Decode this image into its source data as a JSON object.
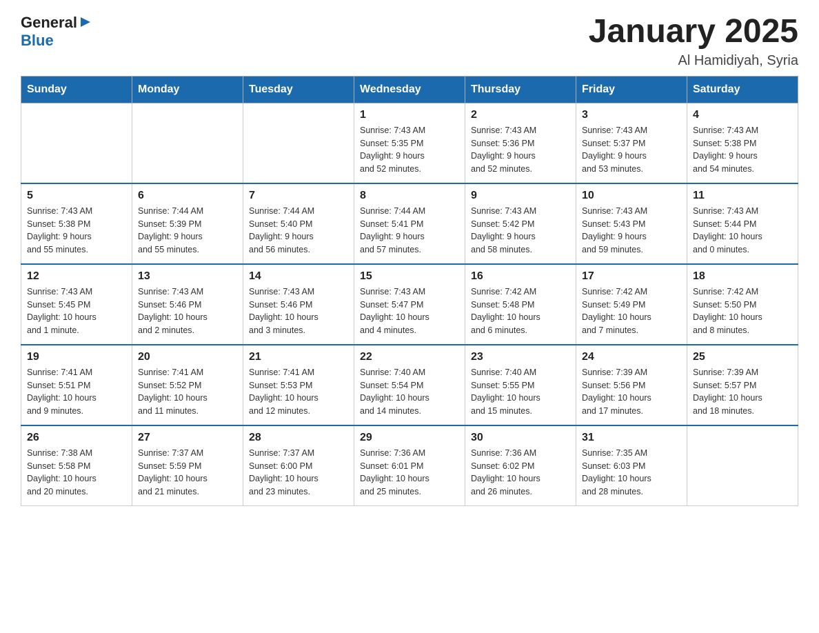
{
  "logo": {
    "general": "General",
    "blue": "Blue"
  },
  "header": {
    "month_year": "January 2025",
    "location": "Al Hamidiyah, Syria"
  },
  "days_of_week": [
    "Sunday",
    "Monday",
    "Tuesday",
    "Wednesday",
    "Thursday",
    "Friday",
    "Saturday"
  ],
  "weeks": [
    [
      {
        "day": "",
        "info": ""
      },
      {
        "day": "",
        "info": ""
      },
      {
        "day": "",
        "info": ""
      },
      {
        "day": "1",
        "info": "Sunrise: 7:43 AM\nSunset: 5:35 PM\nDaylight: 9 hours\nand 52 minutes."
      },
      {
        "day": "2",
        "info": "Sunrise: 7:43 AM\nSunset: 5:36 PM\nDaylight: 9 hours\nand 52 minutes."
      },
      {
        "day": "3",
        "info": "Sunrise: 7:43 AM\nSunset: 5:37 PM\nDaylight: 9 hours\nand 53 minutes."
      },
      {
        "day": "4",
        "info": "Sunrise: 7:43 AM\nSunset: 5:38 PM\nDaylight: 9 hours\nand 54 minutes."
      }
    ],
    [
      {
        "day": "5",
        "info": "Sunrise: 7:43 AM\nSunset: 5:38 PM\nDaylight: 9 hours\nand 55 minutes."
      },
      {
        "day": "6",
        "info": "Sunrise: 7:44 AM\nSunset: 5:39 PM\nDaylight: 9 hours\nand 55 minutes."
      },
      {
        "day": "7",
        "info": "Sunrise: 7:44 AM\nSunset: 5:40 PM\nDaylight: 9 hours\nand 56 minutes."
      },
      {
        "day": "8",
        "info": "Sunrise: 7:44 AM\nSunset: 5:41 PM\nDaylight: 9 hours\nand 57 minutes."
      },
      {
        "day": "9",
        "info": "Sunrise: 7:43 AM\nSunset: 5:42 PM\nDaylight: 9 hours\nand 58 minutes."
      },
      {
        "day": "10",
        "info": "Sunrise: 7:43 AM\nSunset: 5:43 PM\nDaylight: 9 hours\nand 59 minutes."
      },
      {
        "day": "11",
        "info": "Sunrise: 7:43 AM\nSunset: 5:44 PM\nDaylight: 10 hours\nand 0 minutes."
      }
    ],
    [
      {
        "day": "12",
        "info": "Sunrise: 7:43 AM\nSunset: 5:45 PM\nDaylight: 10 hours\nand 1 minute."
      },
      {
        "day": "13",
        "info": "Sunrise: 7:43 AM\nSunset: 5:46 PM\nDaylight: 10 hours\nand 2 minutes."
      },
      {
        "day": "14",
        "info": "Sunrise: 7:43 AM\nSunset: 5:46 PM\nDaylight: 10 hours\nand 3 minutes."
      },
      {
        "day": "15",
        "info": "Sunrise: 7:43 AM\nSunset: 5:47 PM\nDaylight: 10 hours\nand 4 minutes."
      },
      {
        "day": "16",
        "info": "Sunrise: 7:42 AM\nSunset: 5:48 PM\nDaylight: 10 hours\nand 6 minutes."
      },
      {
        "day": "17",
        "info": "Sunrise: 7:42 AM\nSunset: 5:49 PM\nDaylight: 10 hours\nand 7 minutes."
      },
      {
        "day": "18",
        "info": "Sunrise: 7:42 AM\nSunset: 5:50 PM\nDaylight: 10 hours\nand 8 minutes."
      }
    ],
    [
      {
        "day": "19",
        "info": "Sunrise: 7:41 AM\nSunset: 5:51 PM\nDaylight: 10 hours\nand 9 minutes."
      },
      {
        "day": "20",
        "info": "Sunrise: 7:41 AM\nSunset: 5:52 PM\nDaylight: 10 hours\nand 11 minutes."
      },
      {
        "day": "21",
        "info": "Sunrise: 7:41 AM\nSunset: 5:53 PM\nDaylight: 10 hours\nand 12 minutes."
      },
      {
        "day": "22",
        "info": "Sunrise: 7:40 AM\nSunset: 5:54 PM\nDaylight: 10 hours\nand 14 minutes."
      },
      {
        "day": "23",
        "info": "Sunrise: 7:40 AM\nSunset: 5:55 PM\nDaylight: 10 hours\nand 15 minutes."
      },
      {
        "day": "24",
        "info": "Sunrise: 7:39 AM\nSunset: 5:56 PM\nDaylight: 10 hours\nand 17 minutes."
      },
      {
        "day": "25",
        "info": "Sunrise: 7:39 AM\nSunset: 5:57 PM\nDaylight: 10 hours\nand 18 minutes."
      }
    ],
    [
      {
        "day": "26",
        "info": "Sunrise: 7:38 AM\nSunset: 5:58 PM\nDaylight: 10 hours\nand 20 minutes."
      },
      {
        "day": "27",
        "info": "Sunrise: 7:37 AM\nSunset: 5:59 PM\nDaylight: 10 hours\nand 21 minutes."
      },
      {
        "day": "28",
        "info": "Sunrise: 7:37 AM\nSunset: 6:00 PM\nDaylight: 10 hours\nand 23 minutes."
      },
      {
        "day": "29",
        "info": "Sunrise: 7:36 AM\nSunset: 6:01 PM\nDaylight: 10 hours\nand 25 minutes."
      },
      {
        "day": "30",
        "info": "Sunrise: 7:36 AM\nSunset: 6:02 PM\nDaylight: 10 hours\nand 26 minutes."
      },
      {
        "day": "31",
        "info": "Sunrise: 7:35 AM\nSunset: 6:03 PM\nDaylight: 10 hours\nand 28 minutes."
      },
      {
        "day": "",
        "info": ""
      }
    ]
  ]
}
